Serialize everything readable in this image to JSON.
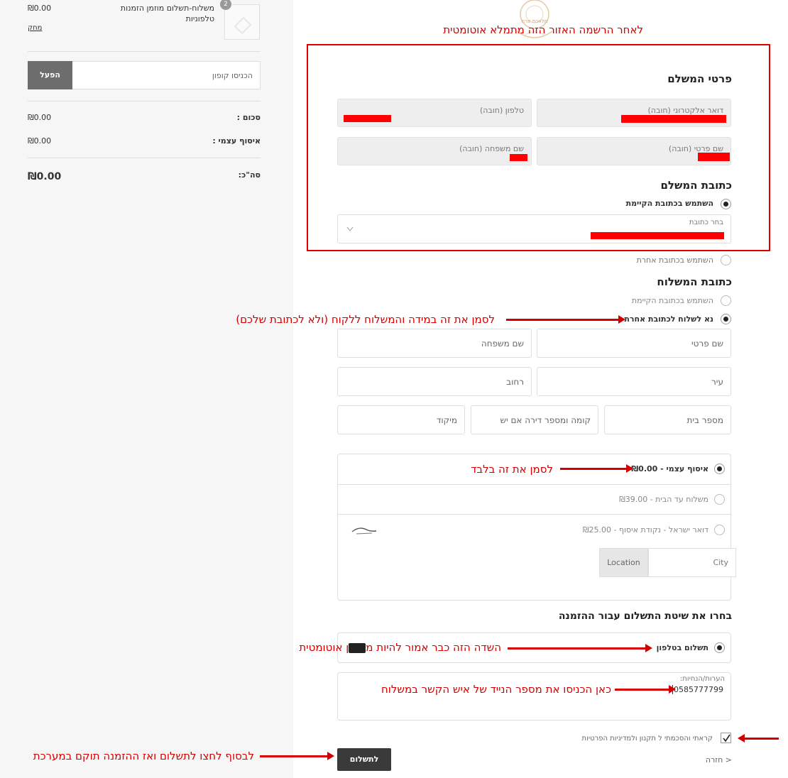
{
  "sidebar": {
    "item_price": "₪0.00",
    "item_remove": "מחק",
    "item_name": "משלוח-תשלום מוזמן הזמנות טלפוניות",
    "item_qty": "2",
    "coupon_placeholder": "הכניסו קופון",
    "coupon_apply": "הפעל",
    "subtotal_label": "סכום :",
    "subtotal_value": "₪0.00",
    "pickup_label": "איסוף עצמי :",
    "pickup_value": "₪0.00",
    "total_label": "סה\"כ:",
    "total_value": "₪0.00"
  },
  "logo_text": "מלאכת פרח",
  "billing": {
    "autofill_note": "לאחר הרשמה האזור הזה מתמלא אוטומטית",
    "title": "פרטי המשלם",
    "email_label": "דואר אלקטרוני (חובה)",
    "phone_label": "טלפון (חובה)",
    "first_name_label": "שם פרטי (חובה)",
    "last_name_label": "שם משפחה (חובה)",
    "address_title": "כתובת המשלם",
    "use_existing": "השתמש בכתובת הקיימת",
    "choose_address": "בחר כתובת",
    "use_other": "השתמש בכתובת אחרת"
  },
  "shipping": {
    "title": "כתובת המשלוח",
    "use_existing": "השתמש בכתובת הקיימת",
    "ship_other": "נא לשלוח לכתובת אחרת",
    "ship_other_note": "לסמן את זה במידה והמשלוח ללקוח (ולא לכתובת שלכם)",
    "first_name": "שם פרטי",
    "last_name": "שם משפחה",
    "city": "עיר",
    "street": "רחוב",
    "house_number": "מספר בית",
    "floor_apartment": "קומה ומספר דירה אם יש",
    "zip": "מיקוד"
  },
  "delivery": {
    "pickup": "איסוף עצמי - ₪0.00",
    "pickup_note": "לסמן את זה בלבד",
    "home": "משלוח עד הבית - ₪39.00",
    "post": "דואר ישראל - נקודת איסוף - ₪25.00",
    "city_placeholder": "City",
    "location_button": "Location"
  },
  "payment": {
    "title": "בחרו את שיטת התשלום עבור ההזמנה",
    "phone_payment": "תשלום בטלפון",
    "phone_payment_note": "השדה הזה כבר אמור להיות מסומן אוטומטית",
    "phone_field_label": "הערות/הנחיות:",
    "phone_field_value": "0585777799",
    "phone_field_note": "כאן הכניסו את מספר הנייד של איש הקשר במשלוח"
  },
  "terms": {
    "label": "קראתי והסכמתי ל תקנון ולמדיניות הפרטיות"
  },
  "footer": {
    "back": "< חזרה",
    "pay_button": "לתשלום",
    "pay_note": "לבסוף לחצו לתשלום ואז ההזמנה תוקם במערכת"
  },
  "colors": {
    "annotation_red": "#d40000",
    "redaction_red": "#ff0000",
    "button_gray": "#6d6d6d",
    "button_dark": "#3a3a3a"
  }
}
